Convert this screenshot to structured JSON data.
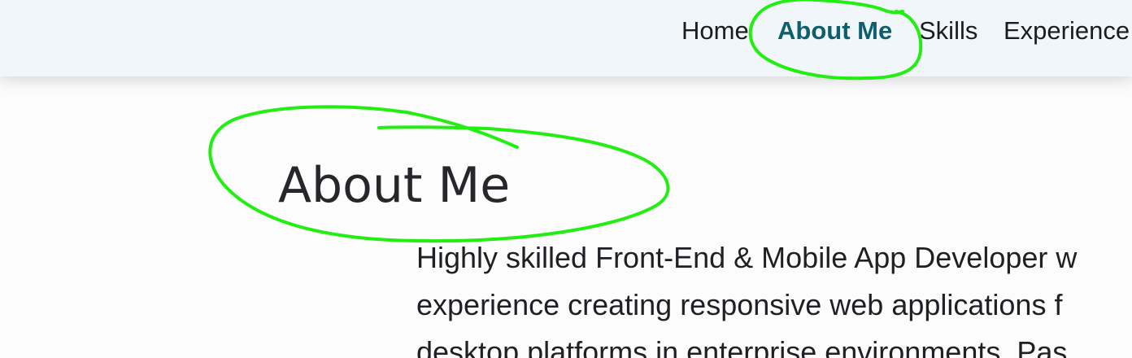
{
  "nav": {
    "items": [
      {
        "label": "Home",
        "active": false
      },
      {
        "label": "About Me",
        "active": true
      },
      {
        "label": "Skills",
        "active": false
      },
      {
        "label": "Experience",
        "active": false
      }
    ]
  },
  "about": {
    "title": "About Me",
    "body_lines": [
      "Highly skilled Front-End & Mobile App Developer w",
      "experience creating responsive web applications f",
      "desktop platforms in enterprise environments. Pas"
    ]
  },
  "colors": {
    "nav_background": "#f1f6fb",
    "active_link": "#0f5e6b",
    "annotation_stroke": "#22ee11"
  }
}
